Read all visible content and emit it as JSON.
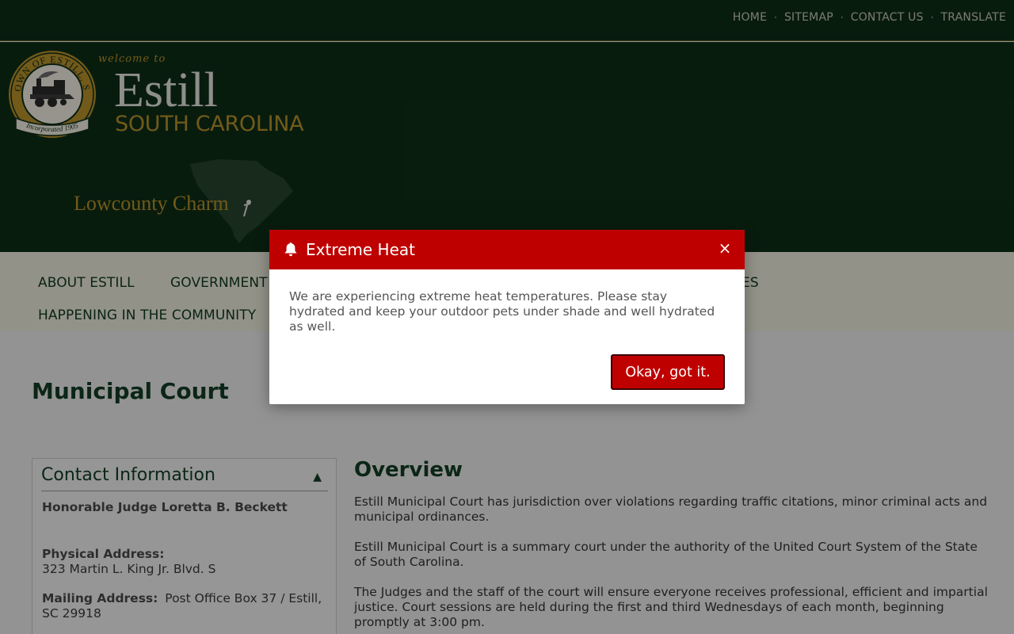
{
  "top_links": [
    "HOME",
    "SITEMAP",
    "CONTACT US",
    "TRANSLATE"
  ],
  "top_separator": "·",
  "header": {
    "welcome": "welcome to",
    "town": "Estill",
    "state": "SOUTH CAROLINA",
    "tagline": "Lowcounty Charm",
    "seal": {
      "top_text": "TOWN OF ESTILL, SC",
      "banner_text": "Incorporated 1905"
    }
  },
  "nav": {
    "items": [
      "ABOUT ESTILL",
      "GOVERNMENT",
      "ES",
      "HAPPENING IN THE COMMUNITY"
    ]
  },
  "page": {
    "title": "Municipal Court"
  },
  "contact": {
    "title": "Contact Information",
    "toggle": "▲",
    "judge": "Honorable Judge Loretta B. Beckett",
    "physical_label": "Physical Address:",
    "physical_value": "323 Martin L. King Jr. Blvd. S",
    "mailing_label": "Mailing Address:",
    "mailing_value": "Post Office Box 37 / Estill, SC 29918"
  },
  "overview": {
    "heading": "Overview",
    "paragraphs": [
      "Estill Municipal Court has jurisdiction over violations regarding traffic citations, minor criminal acts and municipal ordinances.",
      "Estill Municipal Court is a summary court under the authority of the United Court System of the State of South Carolina.",
      "The Judges and the staff of the court will ensure everyone receives professional, efficient and impartial justice.  Court sessions are held during the first and third Wednesdays of each month, beginning promptly at 3:00 pm."
    ]
  },
  "alert": {
    "title": "Extreme Heat",
    "message": "We are experiencing extreme heat temperatures. Please stay hydrated and keep your outdoor pets under shade and well hydrated as well.",
    "button": "Okay, got it.",
    "close": "×",
    "icon": "bell-icon"
  },
  "colors": {
    "header_bg": "#0e2e17",
    "gold": "#b8922a",
    "alert_red": "#bf0000",
    "heading_green": "#123d24"
  }
}
